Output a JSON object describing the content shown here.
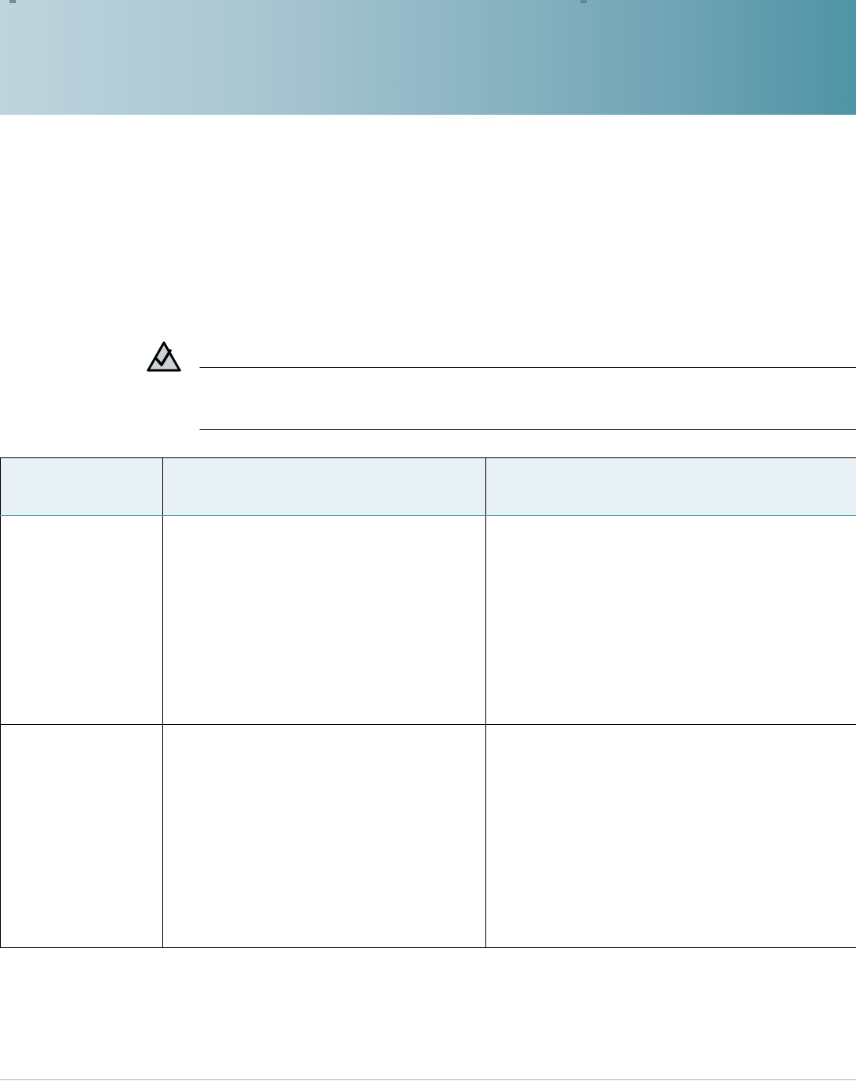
{
  "header": {
    "accent_light": "#bed4dd",
    "accent_dark": "#4f94a6"
  },
  "note": {
    "icon": "note-checkmark-icon"
  },
  "table": {
    "header_background": "#e8f1f5",
    "columns": [
      "",
      "",
      ""
    ],
    "rows": [
      [
        "",
        "",
        ""
      ],
      [
        "",
        "",
        ""
      ]
    ]
  }
}
